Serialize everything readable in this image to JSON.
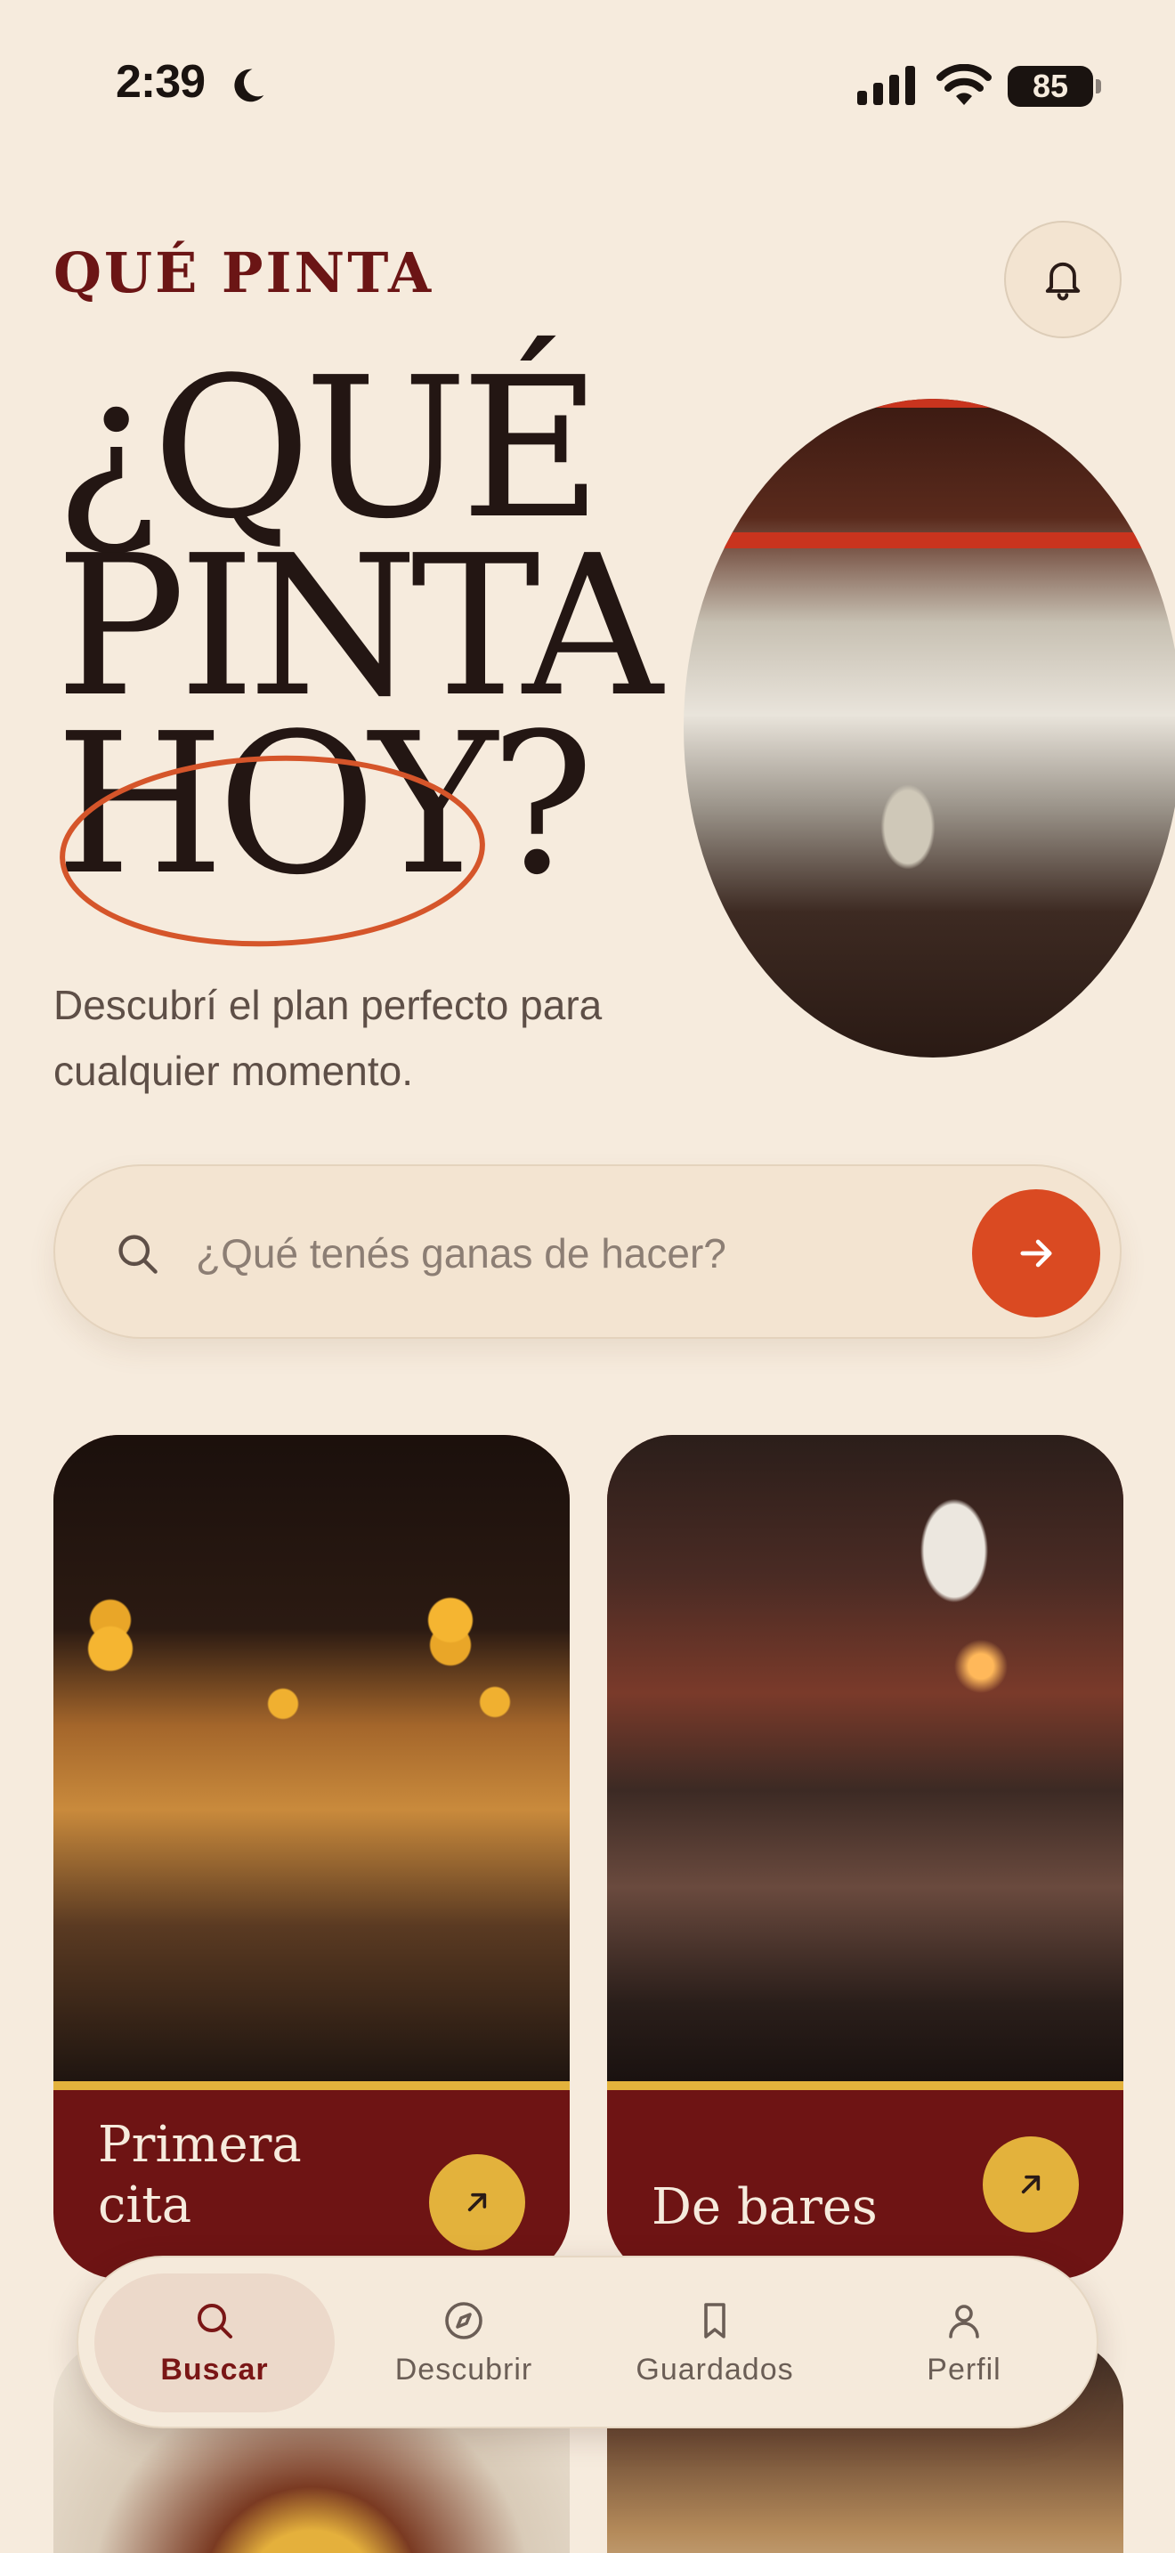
{
  "status_bar": {
    "time": "2:39",
    "battery": "85"
  },
  "header": {
    "brand": "QUÉ PINTA"
  },
  "hero": {
    "title_lines": [
      "¿QUÉ",
      "PINTA",
      "HOY?"
    ],
    "subtitle": "Descubrí el plan perfecto para cualquier momento."
  },
  "search": {
    "placeholder": "¿Qué tenés ganas de hacer?"
  },
  "cards": [
    {
      "label": "Primera cita"
    },
    {
      "label": "De bares"
    }
  ],
  "nav": {
    "items": [
      {
        "label": "Buscar",
        "icon": "search-icon",
        "active": true
      },
      {
        "label": "Descubrir",
        "icon": "compass-icon",
        "active": false
      },
      {
        "label": "Guardados",
        "icon": "bookmark-icon",
        "active": false
      },
      {
        "label": "Perfil",
        "icon": "user-icon",
        "active": false
      }
    ]
  },
  "colors": {
    "background": "#F6EBDD",
    "brand": "#6B1515",
    "accent": "#DA4A22",
    "card": "#6E1414",
    "gold": "#E3B23C"
  }
}
